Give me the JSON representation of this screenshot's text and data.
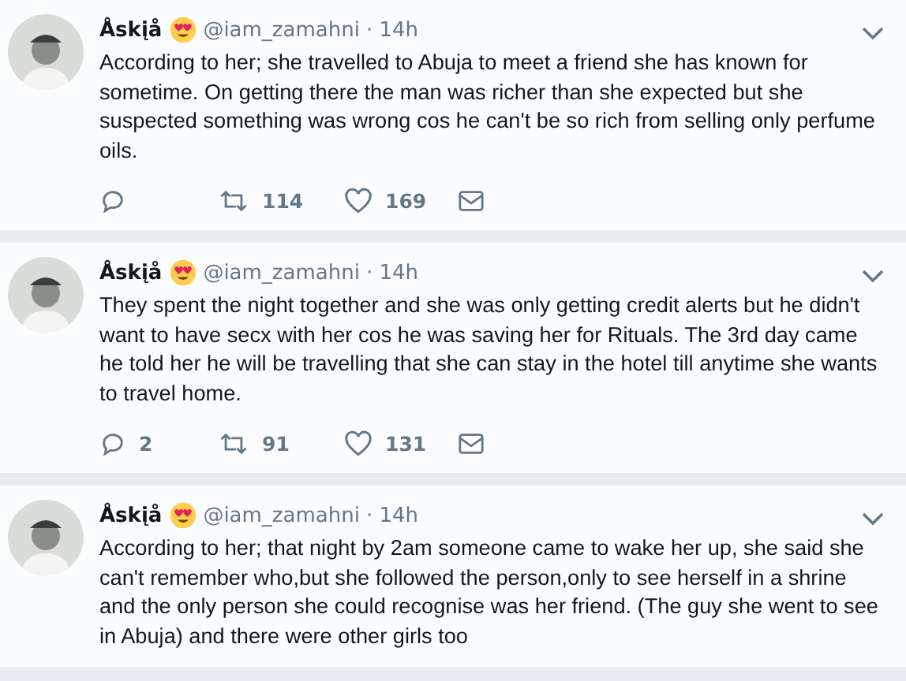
{
  "tweets": [
    {
      "name": "Åskįå",
      "handle": "@iam_zamahni",
      "time": "· 14h",
      "text": "According to her; she travelled to Abuja to meet a friend she has known for sometime. On getting there the man was richer than she expected but she suspected something was wrong cos he can't be so rich from selling only perfume oils.",
      "actions": [
        {
          "kind": "reply"
        },
        {
          "kind": "retweet",
          "count": "114"
        },
        {
          "kind": "like",
          "count": "169"
        },
        {
          "kind": "message"
        }
      ]
    },
    {
      "name": "Åskįå",
      "handle": "@iam_zamahni",
      "time": "· 14h",
      "text": "They spent the night together and she was only getting credit alerts but he didn't want to have secx with her cos he was saving her for Rituals. The 3rd day came he told her he will be travelling that she can stay in the hotel till anytime she wants to travel home.",
      "actions": [
        {
          "kind": "reply",
          "count": "2"
        },
        {
          "kind": "retweet",
          "count": "91"
        },
        {
          "kind": "like",
          "count": "131"
        },
        {
          "kind": "message"
        }
      ]
    },
    {
      "name": "Åskįå",
      "handle": "@iam_zamahni",
      "time": "· 14h",
      "text": "According to her; that night by 2am someone came to wake her up, she said she can't remember who,but she followed the person,only to see herself in a shrine and the only person she could recognise was her friend. (The guy she went to see in Abuja) and there were other girls too"
    }
  ]
}
